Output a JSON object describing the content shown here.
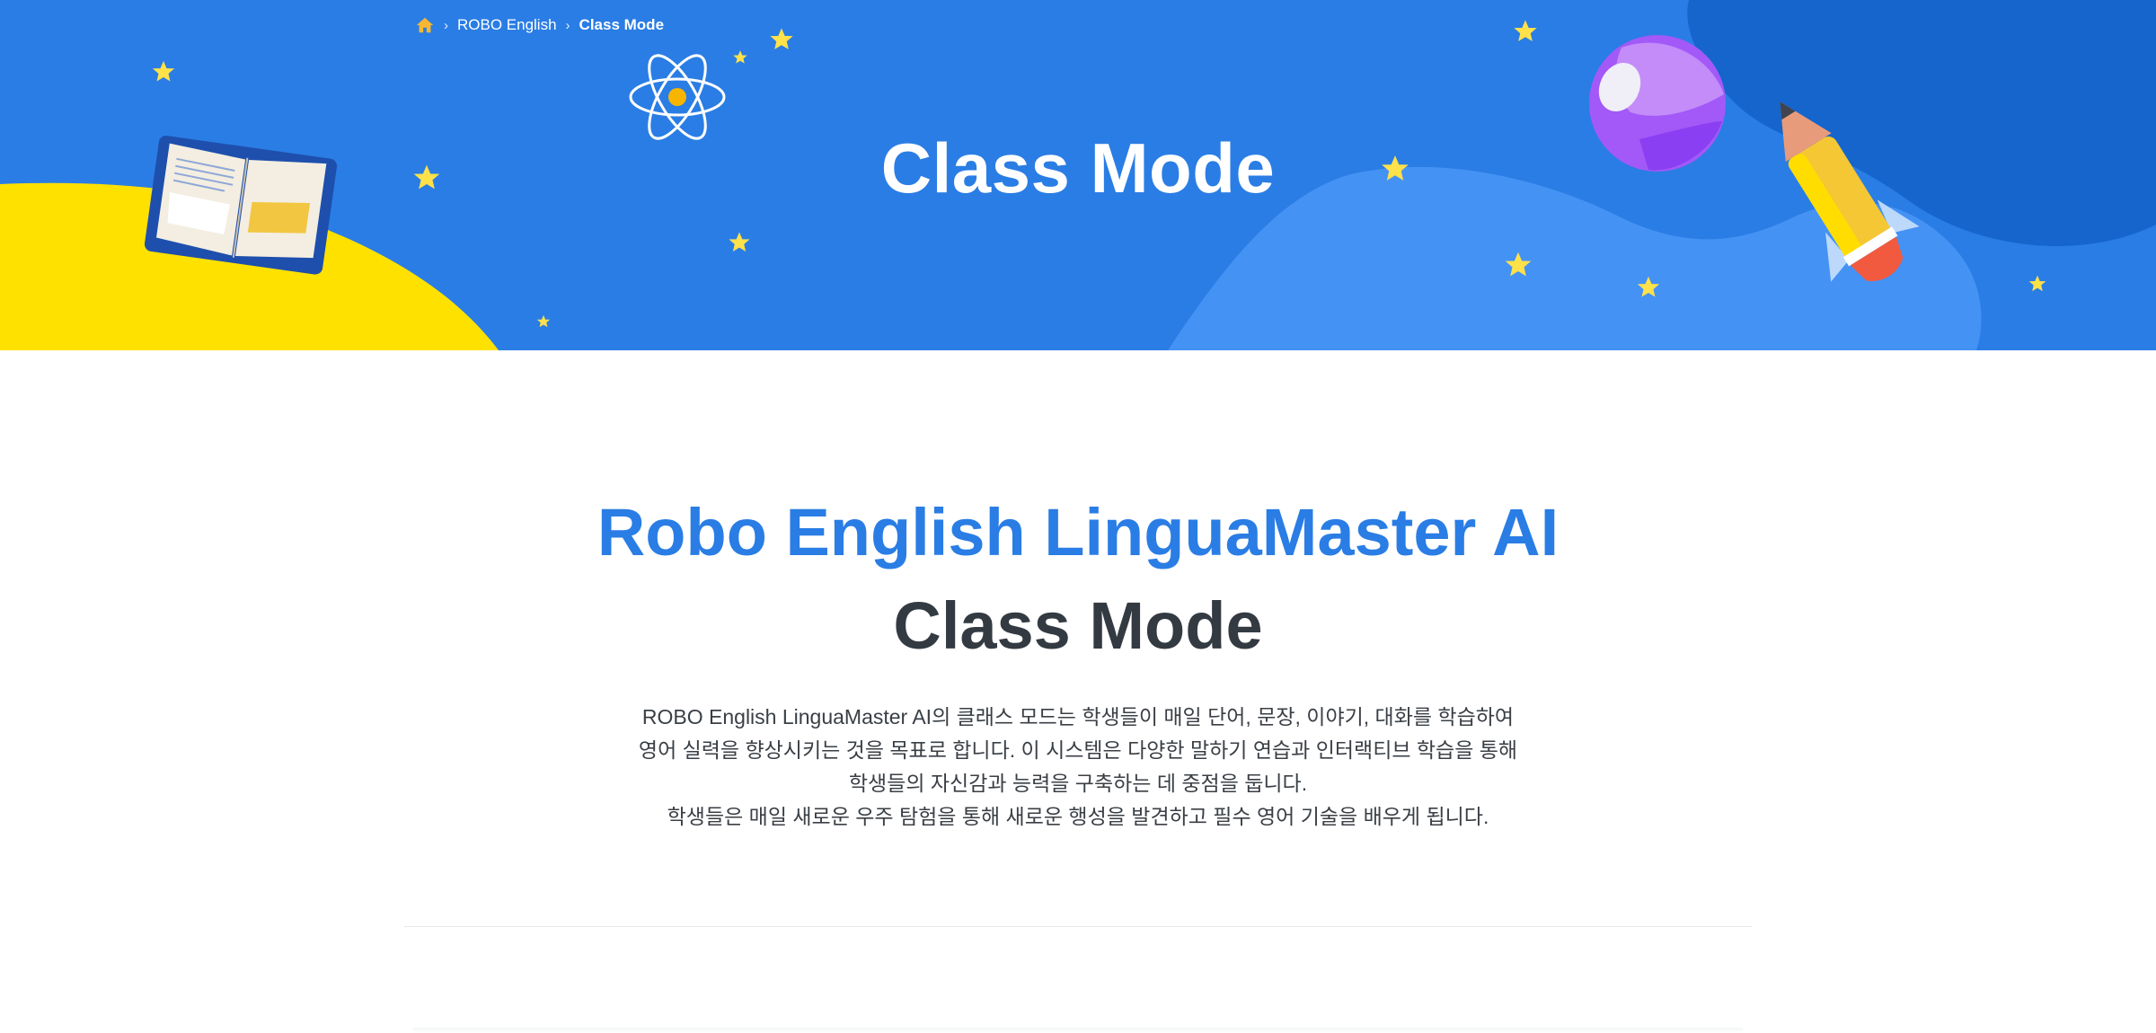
{
  "breadcrumb": {
    "home_icon": "home-icon",
    "items": [
      "ROBO English",
      "Class Mode"
    ]
  },
  "hero": {
    "title": "Class Mode"
  },
  "intro": {
    "title_line1": "Robo English LinguaMaster AI",
    "title_line2": "Class Mode",
    "description": [
      "ROBO English LinguaMaster AI의 클래스 모드는 학생들이 매일 단어, 문장, 이야기, 대화를 학습하여",
      "영어 실력을 향상시키는 것을 목표로 합니다. 이 시스템은 다양한 말하기 연습과 인터랙티브 학습을 통해",
      "학생들의 자신감과 능력을 구축하는 데 중점을 둡니다.",
      "학생들은 매일 새로운 우주 탐험을 통해 새로운 행성을 발견하고 필수 영어 기술을 배우게 됩니다."
    ]
  },
  "colors": {
    "hero_bg": "#2a7de4",
    "accent_blue": "#2a7de4",
    "yellow": "#ffe100",
    "star": "#ffe14a",
    "title_dark": "#333a42"
  }
}
